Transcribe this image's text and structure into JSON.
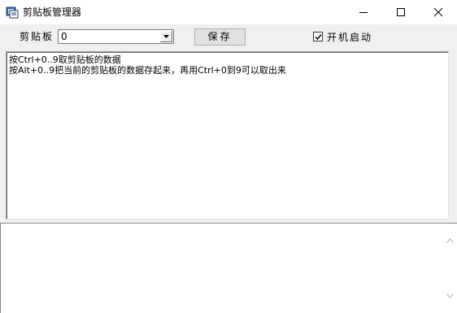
{
  "window": {
    "title": "剪贴板管理器"
  },
  "toolbar": {
    "clip_label": "剪贴板",
    "combo_value": "0",
    "save_label": "保存",
    "autostart_label": "开机启动",
    "autostart_checked": true
  },
  "main": {
    "lines": [
      "按Ctrl+0..9取剪贴板的数据",
      "按Alt+0..9把当前的剪贴板的数据存起来，再用Ctrl+0到9可以取出来"
    ]
  },
  "bottom": {
    "text": ""
  },
  "colors": {
    "window_bg": "#f0f0f0",
    "titlebar_bg": "#ffffff",
    "button_bg": "#e1e1e1",
    "text_area_bg": "#ffffff"
  }
}
